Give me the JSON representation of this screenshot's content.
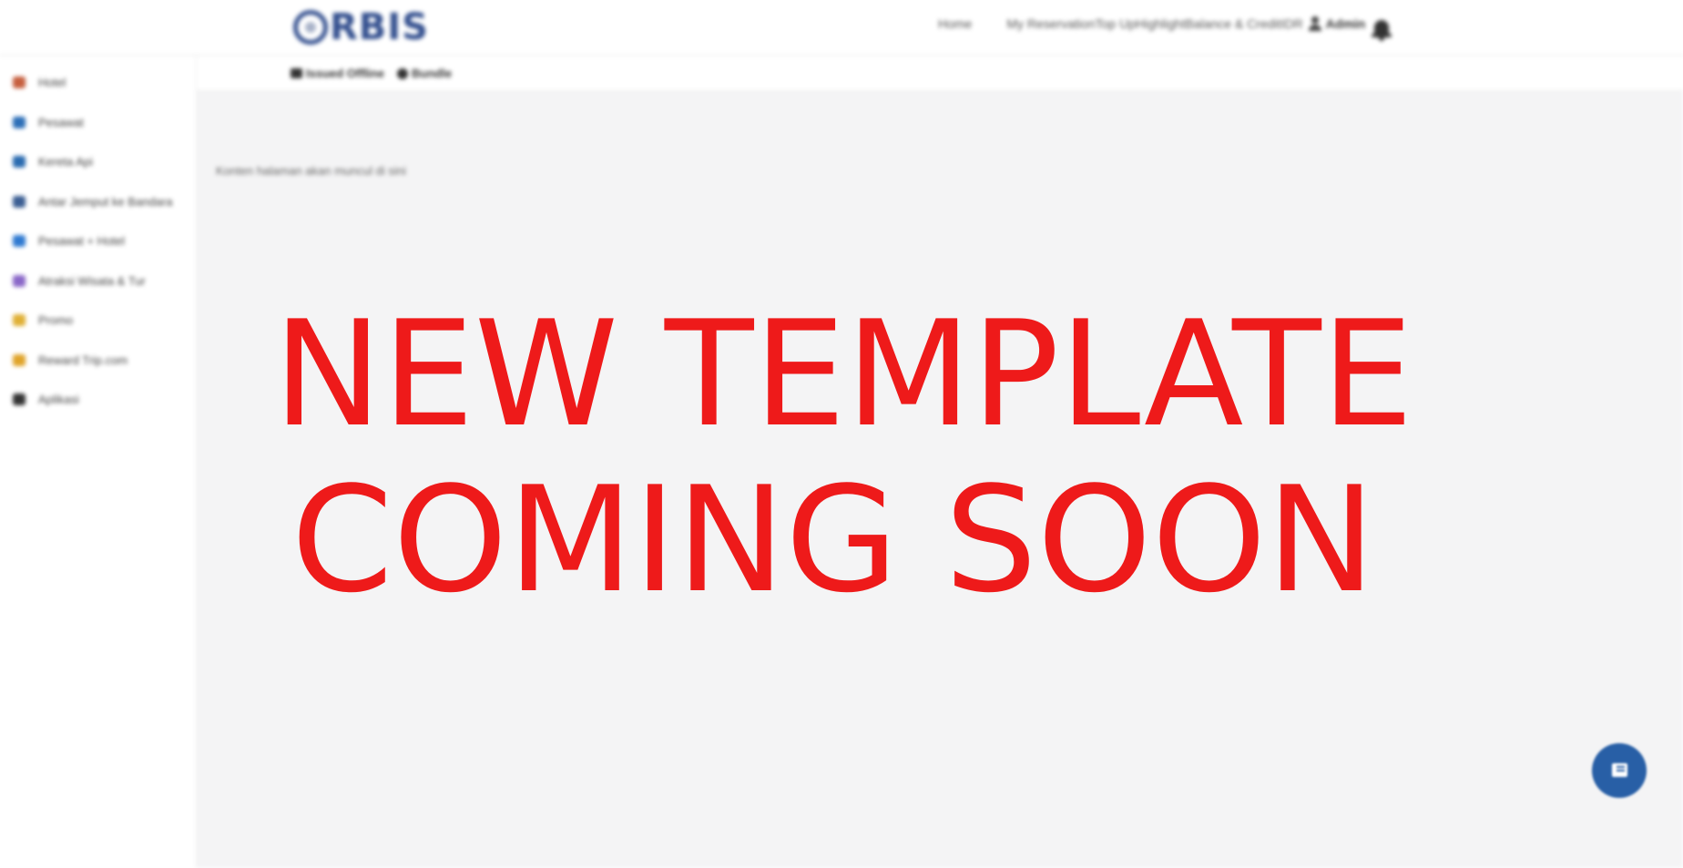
{
  "header": {
    "logo_text": "RBIS",
    "nav": {
      "home": "Home",
      "my_reservation": "My Reservation",
      "top_up": "Top Up",
      "highlight": "Highlight",
      "balance": "Balance & Credit",
      "currency": "IDR",
      "admin": "Admin"
    }
  },
  "subbar": {
    "issued_offline": "Issued Offline",
    "bundle": "Bundle"
  },
  "sidebar": {
    "items": [
      {
        "label": "Hotel",
        "icon": "hotel-icon",
        "color": "#c65f3e"
      },
      {
        "label": "Pesawat",
        "icon": "plane-icon",
        "color": "#2d6fb8"
      },
      {
        "label": "Kereta Api",
        "icon": "train-icon",
        "color": "#2a6bb0"
      },
      {
        "label": "Antar Jemput ke Bandara",
        "icon": "car-icon",
        "color": "#3b5e93"
      },
      {
        "label": "Pesawat + Hotel",
        "icon": "plane-hotel-icon",
        "color": "#2f7ad1"
      },
      {
        "label": "Atraksi Wisata & Tur",
        "icon": "attraction-icon",
        "color": "#8a67c8"
      },
      {
        "label": "Promo",
        "icon": "promo-icon",
        "color": "#e0b036"
      },
      {
        "label": "Reward Trip.com",
        "icon": "reward-icon",
        "color": "#e0a42a"
      },
      {
        "label": "Aplikasi",
        "icon": "phone-icon",
        "color": "#333333"
      }
    ]
  },
  "main": {
    "note": "Konten halaman akan muncul di sini"
  },
  "overlay": {
    "line1": "NEW TEMPLATE",
    "line2": "COMING SOON",
    "color": "#ee1a1a"
  },
  "fab": {
    "icon": "list-icon",
    "color": "#285fa6"
  }
}
